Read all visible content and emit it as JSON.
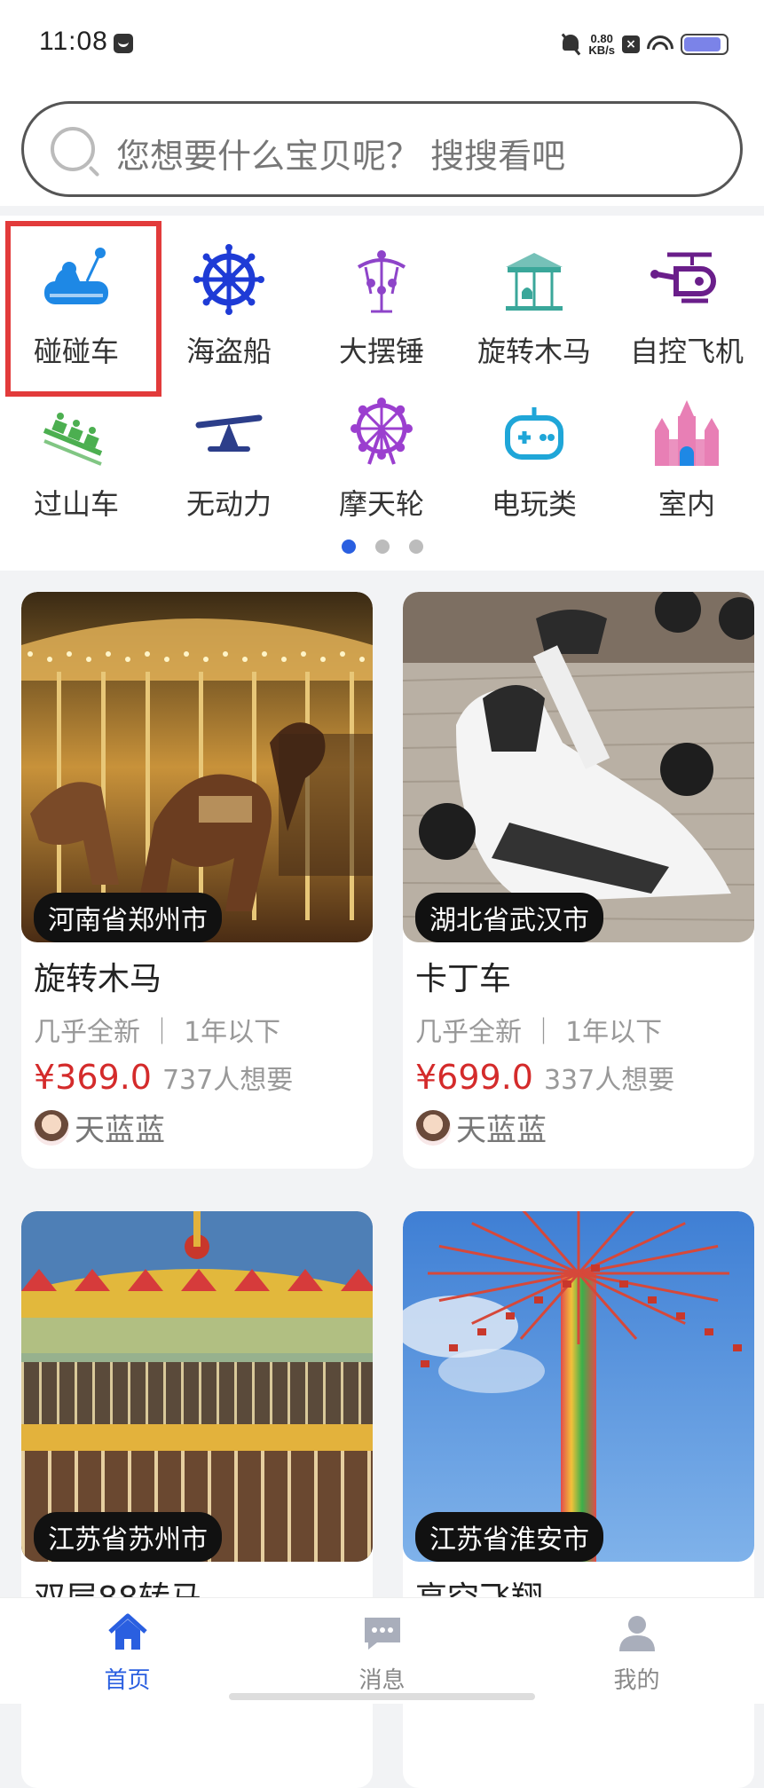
{
  "status": {
    "time": "11:08",
    "net_speed_value": "0.80",
    "net_speed_unit": "KB/s",
    "battery_level": 0.9
  },
  "search": {
    "placeholder": "您想要什么宝贝呢？ 搜搜看吧"
  },
  "categories": [
    {
      "label": "碰碰车",
      "icon": "bumper-car-icon",
      "color": "#1e88e5"
    },
    {
      "label": "海盗船",
      "icon": "ship-wheel-icon",
      "color": "#1e3bd6"
    },
    {
      "label": "大摆锤",
      "icon": "pendulum-ride-icon",
      "color": "#8e44c9"
    },
    {
      "label": "旋转木马",
      "icon": "carousel-icon",
      "color": "#3aa79a"
    },
    {
      "label": "自控飞机",
      "icon": "helicopter-icon",
      "color": "#6a1e8a"
    },
    {
      "label": "过山车",
      "icon": "roller-coaster-icon",
      "color": "#4caf50"
    },
    {
      "label": "无动力",
      "icon": "seesaw-icon",
      "color": "#2c3e8a"
    },
    {
      "label": "摩天轮",
      "icon": "ferris-wheel-icon",
      "color": "#9b3fcf"
    },
    {
      "label": "电玩类",
      "icon": "gamepad-icon",
      "color": "#1fa6d8"
    },
    {
      "label": "室内",
      "icon": "castle-icon",
      "color": "#e87fb5"
    }
  ],
  "pager": {
    "count": 3,
    "active": 0
  },
  "products": [
    {
      "location": "河南省郑州市",
      "title": "旋转木马",
      "condition": "几乎全新 ｜ 1年以下",
      "price": "¥369.0",
      "wants": "737人想要",
      "seller": "天蓝蓝",
      "image": "carousel-horses-photo"
    },
    {
      "location": "湖北省武汉市",
      "title": "卡丁车",
      "condition": "几乎全新 ｜ 1年以下",
      "price": "¥699.0",
      "wants": "337人想要",
      "seller": "天蓝蓝",
      "image": "white-kart-photo"
    },
    {
      "location": "江苏省苏州市",
      "title": "双层88转马",
      "condition": "",
      "price": "",
      "wants": "",
      "seller": "",
      "image": "double-deck-carousel-photo"
    },
    {
      "location": "江苏省淮安市",
      "title": "高空飞翔",
      "condition": "",
      "price": "",
      "wants": "",
      "seller": "",
      "image": "swing-tower-photo"
    }
  ],
  "tabs": [
    {
      "label": "首页",
      "icon": "home-icon",
      "active": true
    },
    {
      "label": "消息",
      "icon": "message-icon",
      "active": false
    },
    {
      "label": "我的",
      "icon": "profile-icon",
      "active": false
    }
  ],
  "colors": {
    "accent": "#2a5fe0",
    "price": "#d42b2b",
    "highlight": "#e23b3b"
  }
}
